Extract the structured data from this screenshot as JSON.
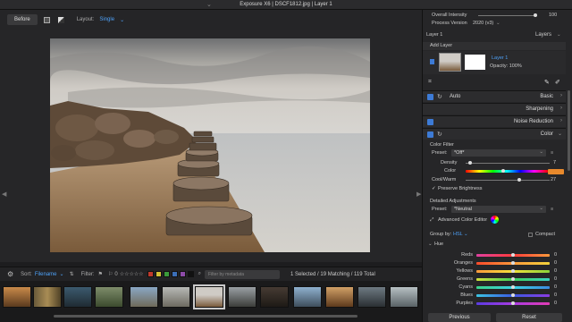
{
  "window": {
    "title": "Exposure X6 | DSCF1812.jpg | Layer 1"
  },
  "toolbar": {
    "before_label": "Before",
    "layout_label": "Layout:",
    "layout_value": "Single"
  },
  "filmstrip_bar": {
    "sort_label": "Sort:",
    "sort_value": "Filename",
    "filter_label": "Filter:",
    "flag_count": "0",
    "metadata_placeholder": "Filter by metadata",
    "status": "1 Selected / 19 Matching / 119 Total",
    "color_labels": [
      "#c0392b",
      "#d4c235",
      "#3a9b3a",
      "#3b6fb8",
      "#8d4ba8",
      "#111111"
    ]
  },
  "right_panel": {
    "overall_intensity": {
      "label": "Overall Intensity",
      "value": "100"
    },
    "process_version": {
      "label": "Process Version",
      "value": "2020 (v3)"
    },
    "layer_title": "Layer 1",
    "layers_header": "Layers",
    "add_layer": "Add Layer",
    "layer_name": "Layer 1",
    "opacity": "Opacity: 100%",
    "sections": {
      "auto": "Auto",
      "basic": "Basic",
      "sharpening": "Sharpening",
      "noise_reduction": "Noise Reduction",
      "color": "Color"
    },
    "color_filter": {
      "title": "Color Filter",
      "preset_label": "Preset:",
      "preset_value": "*Off*",
      "density_label": "Density",
      "density_value": "7",
      "color_label": "Color",
      "coolwarm_label": "Cool/Warm",
      "coolwarm_value": "27",
      "preserve_label": "Preserve Brightness"
    },
    "detailed": {
      "title": "Detailed Adjustments",
      "preset_label": "Preset:",
      "preset_value": "*Neutral",
      "editor_label": "Advanced Color Editor",
      "group_label": "Group by:",
      "group_value": "HSL",
      "compact_label": "Compact",
      "hue_label": "Hue",
      "rows": [
        {
          "name": "Reds",
          "value": "0"
        },
        {
          "name": "Oranges",
          "value": "0"
        },
        {
          "name": "Yellows",
          "value": "0"
        },
        {
          "name": "Greens",
          "value": "0"
        },
        {
          "name": "Cyans",
          "value": "0"
        },
        {
          "name": "Blues",
          "value": "0"
        },
        {
          "name": "Purples",
          "value": "0"
        }
      ]
    },
    "previous_label": "Previous",
    "reset_label": "Reset"
  }
}
